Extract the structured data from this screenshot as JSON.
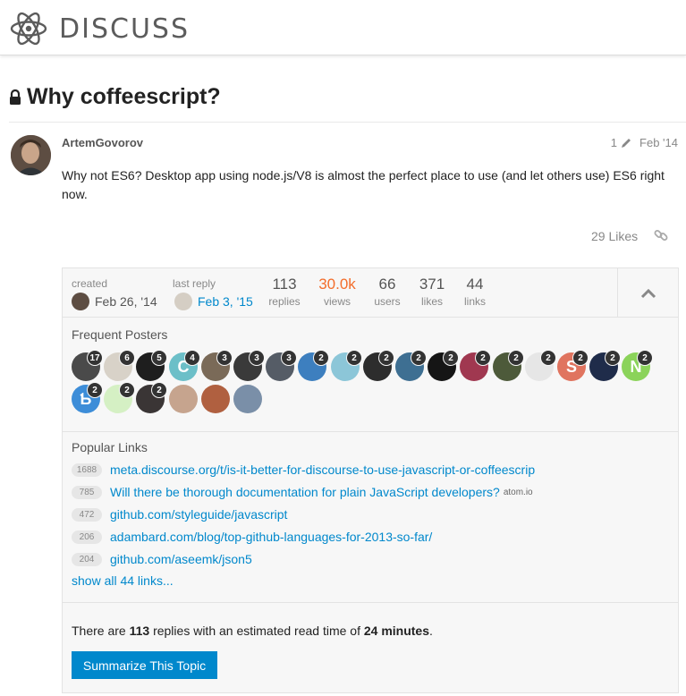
{
  "header": {
    "logo_text": "DISCUSS"
  },
  "topic": {
    "title": "Why coffeescript?"
  },
  "post": {
    "username": "ArtemGovorov",
    "edit_count": "1",
    "date": "Feb '14",
    "body": "Why not ES6? Desktop app using node.js/V8 is almost the perfect place to use (and let others use) ES6 right now.",
    "likes": "29 Likes"
  },
  "topic_map": {
    "created_label": "created",
    "created_date": "Feb 26, '14",
    "last_reply_label": "last reply",
    "last_reply_date": "Feb 3, '15",
    "stats": [
      {
        "value": "113",
        "label": "replies"
      },
      {
        "value": "30.0k",
        "label": "views"
      },
      {
        "value": "66",
        "label": "users"
      },
      {
        "value": "371",
        "label": "likes"
      },
      {
        "value": "44",
        "label": "links"
      }
    ],
    "frequent_posters_title": "Frequent Posters",
    "posters": [
      {
        "color": "#4a4a4a",
        "count": "17"
      },
      {
        "color": "#d8d2c8",
        "count": "6"
      },
      {
        "color": "#1e1e1e",
        "count": "5"
      },
      {
        "color": "#6cbfc8",
        "count": "4",
        "letter": "C"
      },
      {
        "color": "#7a6a58",
        "count": "3"
      },
      {
        "color": "#3a3a3a",
        "count": "3"
      },
      {
        "color": "#555c66",
        "count": "3"
      },
      {
        "color": "#3d7fbf",
        "count": "2"
      },
      {
        "color": "#8cc6d8",
        "count": "2"
      },
      {
        "color": "#2d2d2d",
        "count": "2"
      },
      {
        "color": "#3e6f92",
        "count": "2"
      },
      {
        "color": "#151515",
        "count": "2"
      },
      {
        "color": "#a03850",
        "count": "2"
      },
      {
        "color": "#4d5a3a",
        "count": "2"
      },
      {
        "color": "#e6e6e6",
        "count": "2"
      },
      {
        "color": "#e0745f",
        "count": "2",
        "letter": "S"
      },
      {
        "color": "#1f2c4a",
        "count": "2"
      },
      {
        "color": "#8bd35a",
        "count": "2",
        "letter": "N"
      },
      {
        "color": "#3d8dd8",
        "count": "2",
        "letter": "Ƅ"
      },
      {
        "color": "#d5f0c4",
        "count": "2"
      },
      {
        "color": "#3a3535",
        "count": "2"
      },
      {
        "color": "#c6a48e",
        "count": ""
      },
      {
        "color": "#b06040",
        "count": ""
      },
      {
        "color": "#7a8fa8",
        "count": ""
      }
    ],
    "popular_links_title": "Popular Links",
    "links": [
      {
        "clicks": "1688",
        "text": "meta.discourse.org/t/is-it-better-for-discourse-to-use-javascript-or-coffeescrip",
        "domain": ""
      },
      {
        "clicks": "785",
        "text": "Will there be thorough documentation for plain JavaScript developers?",
        "domain": "atom.io"
      },
      {
        "clicks": "472",
        "text": "github.com/styleguide/javascript",
        "domain": ""
      },
      {
        "clicks": "206",
        "text": "adambard.com/blog/top-github-languages-for-2013-so-far/",
        "domain": ""
      },
      {
        "clicks": "204",
        "text": "github.com/aseemk/json5",
        "domain": ""
      }
    ],
    "show_all": "show all 44 links...",
    "summary_prefix": "There are ",
    "summary_replies": "113",
    "summary_mid": " replies with an estimated read time of ",
    "summary_time": "24 minutes",
    "summary_suffix": ".",
    "summarize_button": "Summarize This Topic"
  },
  "colors": {
    "accent": "#0088cc",
    "views": "#f36d2b"
  }
}
